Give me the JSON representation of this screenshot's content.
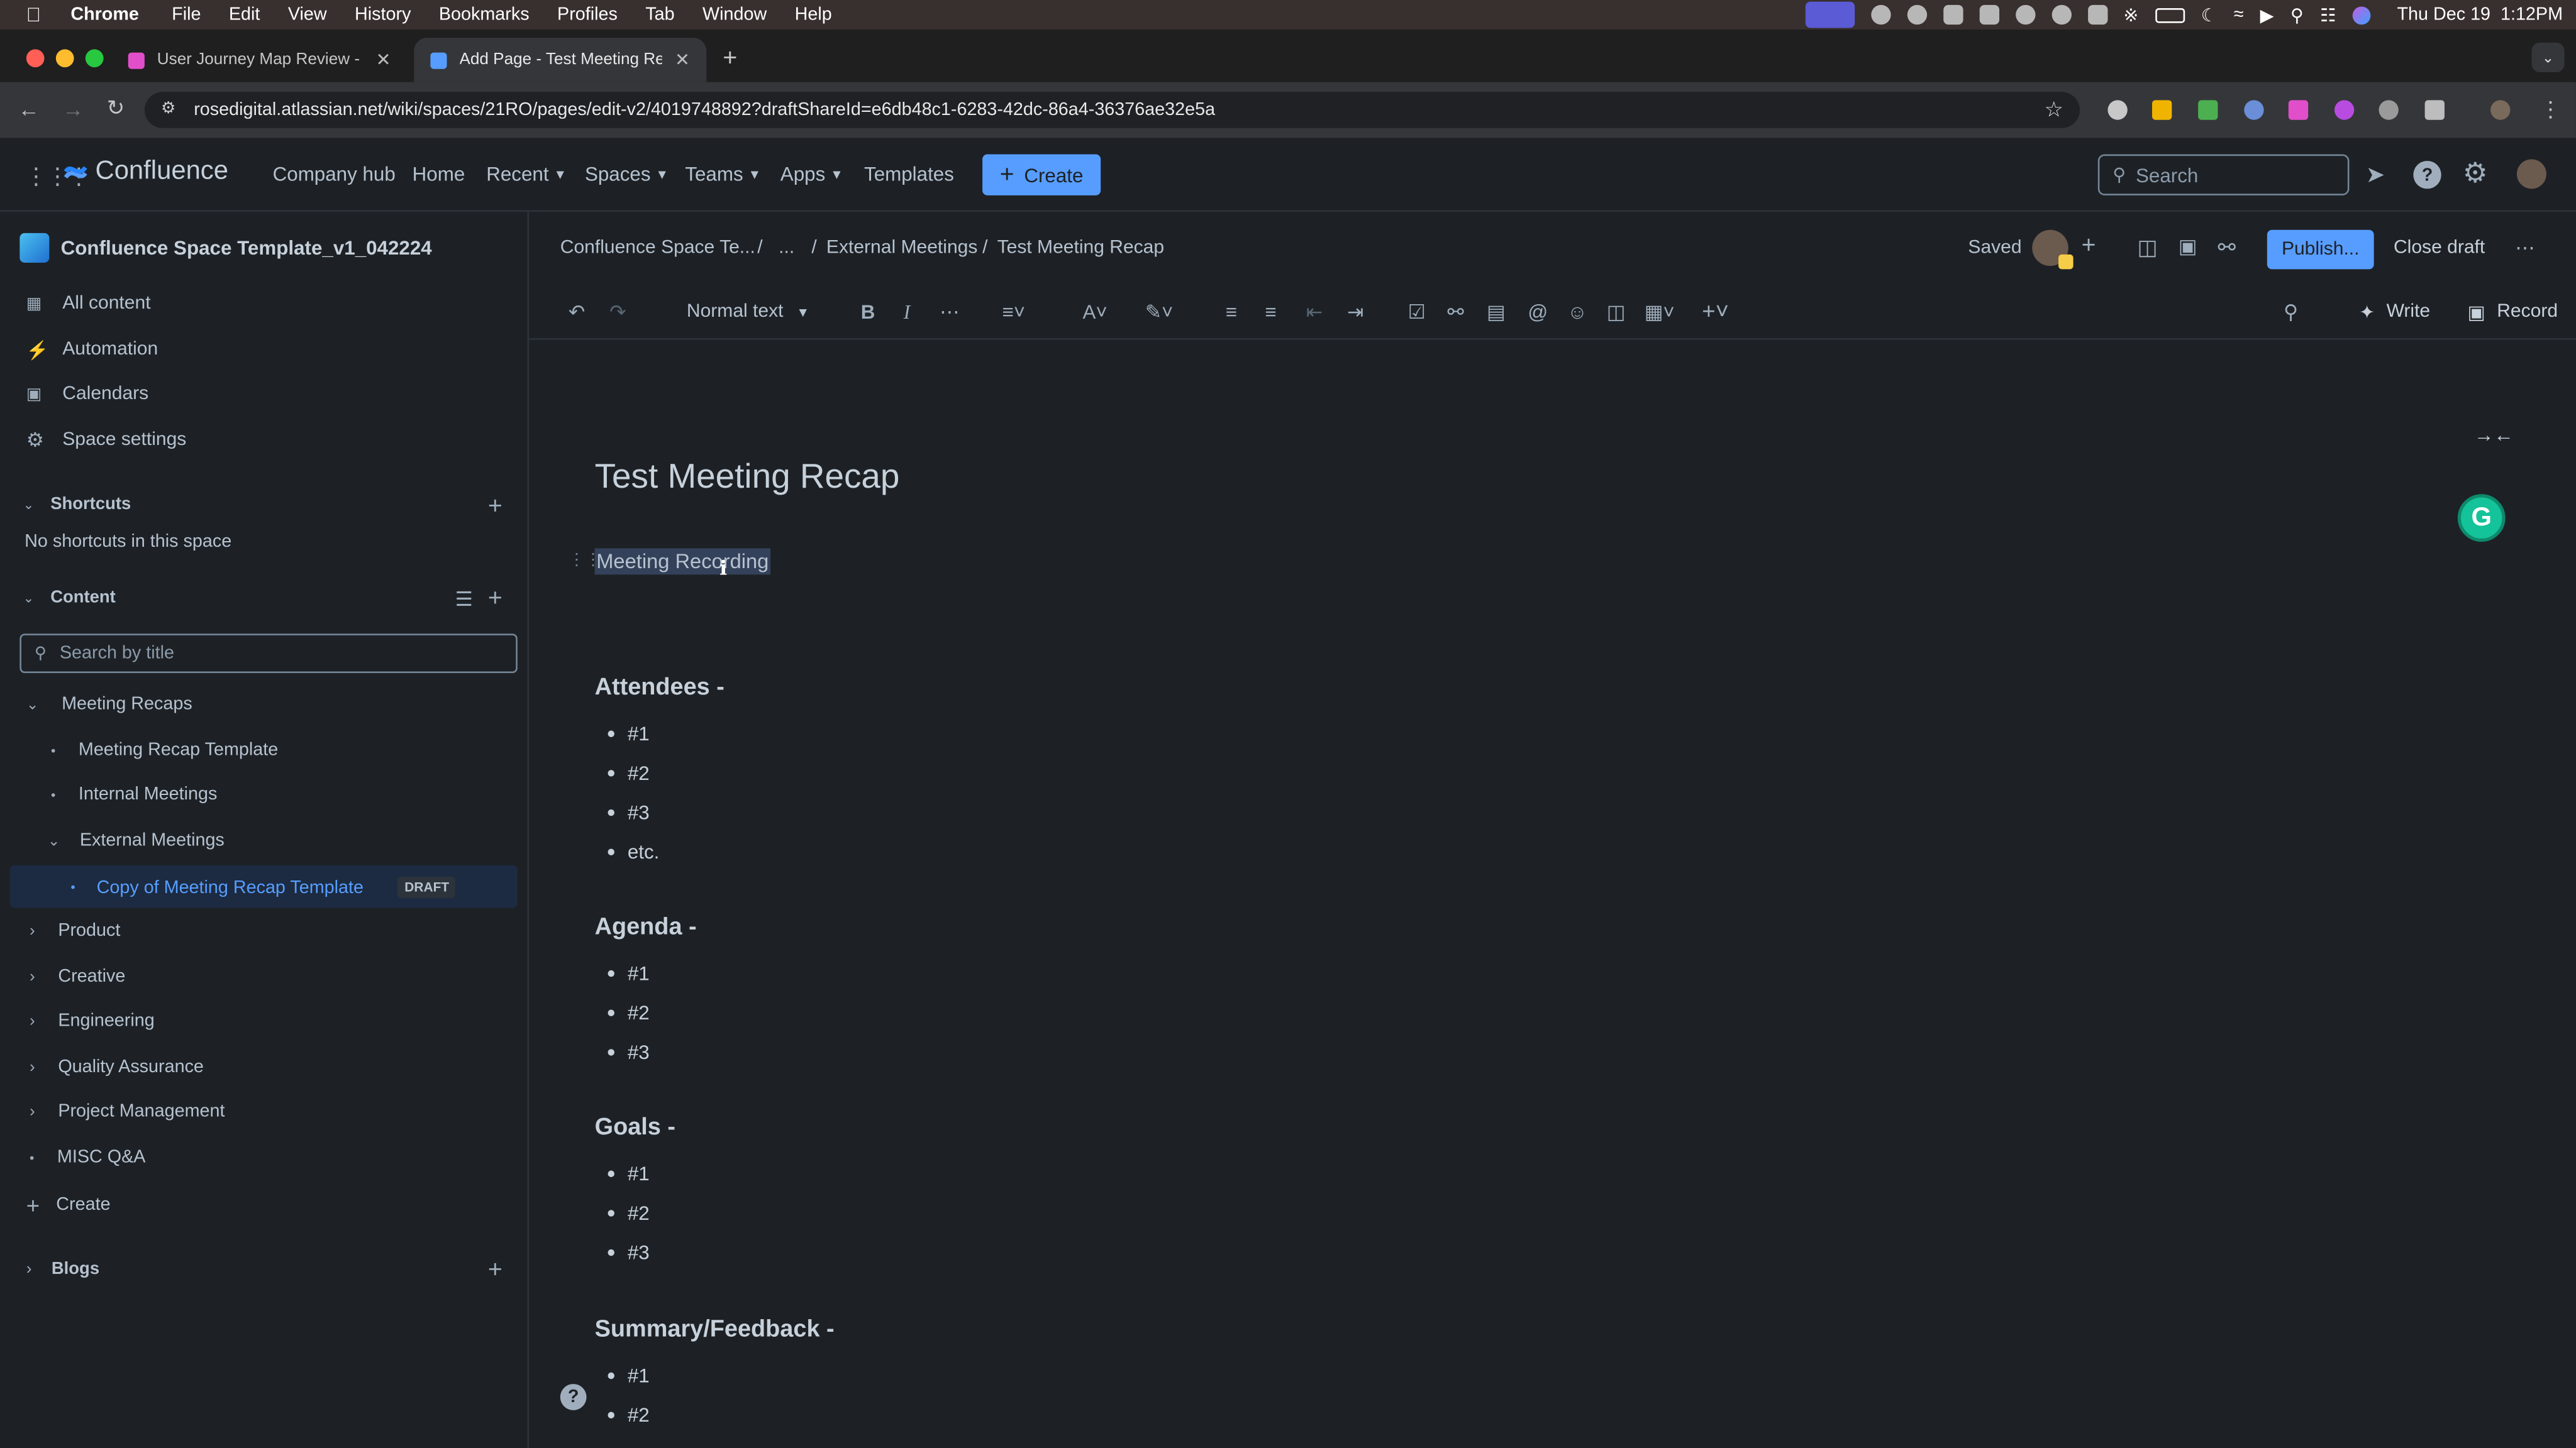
{
  "menubar": {
    "app": "Chrome",
    "items": [
      "File",
      "Edit",
      "View",
      "History",
      "Bookmarks",
      "Profiles",
      "Tab",
      "Window",
      "Help"
    ],
    "datetime": "Thu Dec 19  1:12PM"
  },
  "tabs": [
    {
      "title": "User Journey Map Review - M",
      "active": false
    },
    {
      "title": "Add Page - Test Meeting Rec",
      "active": true
    }
  ],
  "address": {
    "url": "rosedigital.atlassian.net/wiki/spaces/21RO/pages/edit-v2/4019748892?draftShareId=e6db48c1-6283-42dc-86a4-36376ae32e5a"
  },
  "header": {
    "brand": "Confluence",
    "nav": [
      {
        "label": "Company hub",
        "dropdown": false
      },
      {
        "label": "Home",
        "dropdown": false
      },
      {
        "label": "Recent",
        "dropdown": true
      },
      {
        "label": "Spaces",
        "dropdown": true
      },
      {
        "label": "Teams",
        "dropdown": true
      },
      {
        "label": "Apps",
        "dropdown": true
      },
      {
        "label": "Templates",
        "dropdown": false
      }
    ],
    "create_label": "Create",
    "search_placeholder": "Search"
  },
  "sidebar": {
    "space_name": "Confluence Space Template_v1_042224",
    "menu": [
      {
        "label": "All content",
        "icon": "all-content-icon"
      },
      {
        "label": "Automation",
        "icon": "lightning-icon"
      },
      {
        "label": "Calendars",
        "icon": "calendar-icon"
      },
      {
        "label": "Space settings",
        "icon": "gear-icon"
      }
    ],
    "shortcuts_title": "Shortcuts",
    "shortcuts_empty": "No shortcuts in this space",
    "content_title": "Content",
    "search_placeholder": "Search by title",
    "tree": [
      {
        "label": "Meeting Recaps",
        "level": 0,
        "toggle": "expanded"
      },
      {
        "label": "Meeting Recap Template",
        "level": 1,
        "toggle": "dot"
      },
      {
        "label": "Internal Meetings",
        "level": 1,
        "toggle": "dot"
      },
      {
        "label": "External Meetings",
        "level": 1,
        "toggle": "expanded"
      },
      {
        "label": "Copy of Meeting Recap Template",
        "level": 2,
        "toggle": "dot",
        "badge": "DRAFT",
        "selected": true
      },
      {
        "label": "Product",
        "level": 0,
        "toggle": "collapsed"
      },
      {
        "label": "Creative",
        "level": 0,
        "toggle": "collapsed"
      },
      {
        "label": "Engineering",
        "level": 0,
        "toggle": "collapsed"
      },
      {
        "label": "Quality Assurance",
        "level": 0,
        "toggle": "collapsed"
      },
      {
        "label": "Project Management",
        "level": 0,
        "toggle": "collapsed"
      },
      {
        "label": "MISC Q&A",
        "level": 0,
        "toggle": "dot"
      }
    ],
    "create_label": "Create",
    "blogs_title": "Blogs"
  },
  "editor": {
    "breadcrumb": [
      "Confluence Space Te...",
      "...",
      "External Meetings",
      "Test Meeting Recap"
    ],
    "saved_label": "Saved",
    "publish_label": "Publish...",
    "close_draft_label": "Close draft",
    "text_style": "Normal text",
    "write_label": "Write",
    "record_label": "Record"
  },
  "document": {
    "title": "Test Meeting Recap",
    "selected_text": "Meeting Recording",
    "sections": [
      {
        "heading": "Attendees -",
        "items": [
          "#1",
          "#2",
          "#3",
          "etc."
        ]
      },
      {
        "heading": "Agenda -",
        "items": [
          "#1",
          "#2",
          "#3"
        ]
      },
      {
        "heading": "Goals -",
        "items": [
          "#1",
          "#2",
          "#3"
        ]
      },
      {
        "heading": "Summary/Feedback -",
        "items": [
          "#1",
          "#2"
        ]
      }
    ]
  },
  "colors": {
    "accent": "#579dff",
    "background": "#1d2125",
    "selection": "#1c2b41"
  }
}
